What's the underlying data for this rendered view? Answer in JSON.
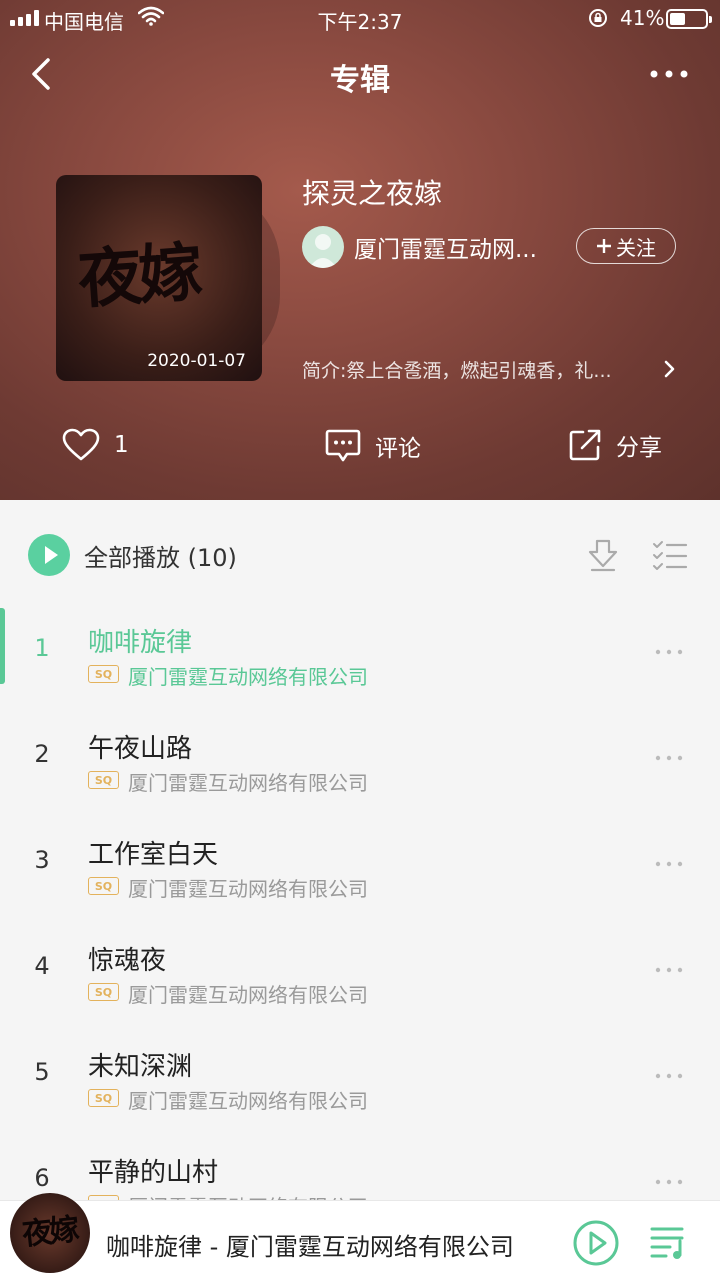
{
  "status_bar": {
    "carrier": "中国电信",
    "time": "下午2:37",
    "battery": "41%",
    "battery_level": 0.41
  },
  "nav": {
    "title": "专辑",
    "back_icon": "chevron-left-icon",
    "more_icon": "more-horizontal-icon"
  },
  "album": {
    "title": "探灵之夜嫁",
    "cover_text": "夜嫁",
    "release_date": "2020-01-07",
    "artist": "厦门雷霆互动网...",
    "follow_label": "关注",
    "intro": "简介:祭上合卺酒，燃起引魂香，礼..."
  },
  "actions": {
    "like_count": "1",
    "comment_label": "评论",
    "share_label": "分享"
  },
  "tracklist": {
    "play_all_label": "全部播放 (10)",
    "accent_color": "#5ac896",
    "tracks": [
      {
        "num": "1",
        "name": "咖啡旋律",
        "quality": "SQ",
        "artist": "厦门雷霆互动网络有限公司"
      },
      {
        "num": "2",
        "name": "午夜山路",
        "quality": "SQ",
        "artist": "厦门雷霆互动网络有限公司"
      },
      {
        "num": "3",
        "name": "工作室白天",
        "quality": "SQ",
        "artist": "厦门雷霆互动网络有限公司"
      },
      {
        "num": "4",
        "name": "惊魂夜",
        "quality": "SQ",
        "artist": "厦门雷霆互动网络有限公司"
      },
      {
        "num": "5",
        "name": "未知深渊",
        "quality": "SQ",
        "artist": "厦门雷霆互动网络有限公司"
      },
      {
        "num": "6",
        "name": "平静的山村",
        "quality": "SQ",
        "artist": "厦门雷霆互动网络有限公司"
      }
    ]
  },
  "player": {
    "cover_text": "夜嫁",
    "now_playing": "咖啡旋律 - 厦门雷霆互动网络有限公司"
  }
}
